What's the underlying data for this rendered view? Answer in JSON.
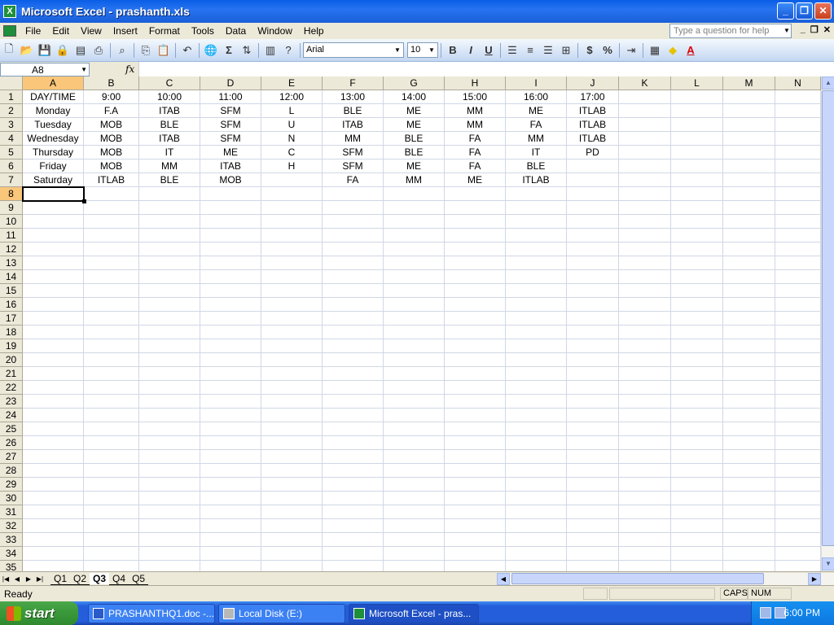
{
  "window": {
    "title": "Microsoft Excel - prashanth.xls",
    "app_icon": "X"
  },
  "menu": [
    "File",
    "Edit",
    "View",
    "Insert",
    "Format",
    "Tools",
    "Data",
    "Window",
    "Help"
  ],
  "help_placeholder": "Type a question for help",
  "toolbar": {
    "font": "Arial",
    "size": "10",
    "bold": "B",
    "italic": "I",
    "underline": "U",
    "currency": "$",
    "percent": "%",
    "sigma": "Σ"
  },
  "formula_bar": {
    "name_box": "A8",
    "fx": "fx",
    "content": ""
  },
  "columns": [
    "A",
    "B",
    "C",
    "D",
    "E",
    "F",
    "G",
    "H",
    "I",
    "J",
    "K",
    "L",
    "M",
    "N"
  ],
  "rows": [
    "1",
    "2",
    "3",
    "4",
    "5",
    "6",
    "7",
    "8",
    "9",
    "10",
    "11",
    "12",
    "13",
    "14",
    "15",
    "16",
    "17",
    "18",
    "19",
    "20",
    "21",
    "22",
    "23",
    "24",
    "25",
    "26",
    "27",
    "28",
    "29",
    "30",
    "31",
    "32",
    "33",
    "34",
    "35"
  ],
  "cells": [
    [
      "DAY/TIME",
      "9:00",
      "10:00",
      "11:00",
      "12:00",
      "13:00",
      "14:00",
      "15:00",
      "16:00",
      "17:00"
    ],
    [
      "Monday",
      "F.A",
      "ITAB",
      "SFM",
      "L",
      "BLE",
      "ME",
      "MM",
      "ME",
      "ITLAB"
    ],
    [
      "Tuesday",
      "MOB",
      "BLE",
      "SFM",
      "U",
      "ITAB",
      "ME",
      "MM",
      "FA",
      "ITLAB"
    ],
    [
      "Wednesday",
      "MOB",
      "ITAB",
      "SFM",
      "N",
      "MM",
      "BLE",
      "FA",
      "MM",
      "ITLAB"
    ],
    [
      "Thursday",
      "MOB",
      "IT",
      "ME",
      "C",
      "SFM",
      "BLE",
      "FA",
      "IT",
      "PD"
    ],
    [
      "Friday",
      "MOB",
      "MM",
      "ITAB",
      "H",
      "SFM",
      "ME",
      "FA",
      "BLE",
      ""
    ],
    [
      "Saturday",
      "ITLAB",
      "BLE",
      "MOB",
      "",
      "FA",
      "MM",
      "ME",
      "ITLAB",
      ""
    ]
  ],
  "sheets": [
    "Q1",
    "Q2",
    "Q3",
    "Q4",
    "Q5"
  ],
  "active_sheet": "Q3",
  "status": {
    "ready": "Ready",
    "caps": "CAPS",
    "num": "NUM"
  },
  "taskbar": {
    "start": "start",
    "tasks": [
      "PRASHANTHQ1.doc -...",
      "Local Disk (E:)",
      "Microsoft Excel - pras..."
    ],
    "clock": "6:00 PM"
  }
}
